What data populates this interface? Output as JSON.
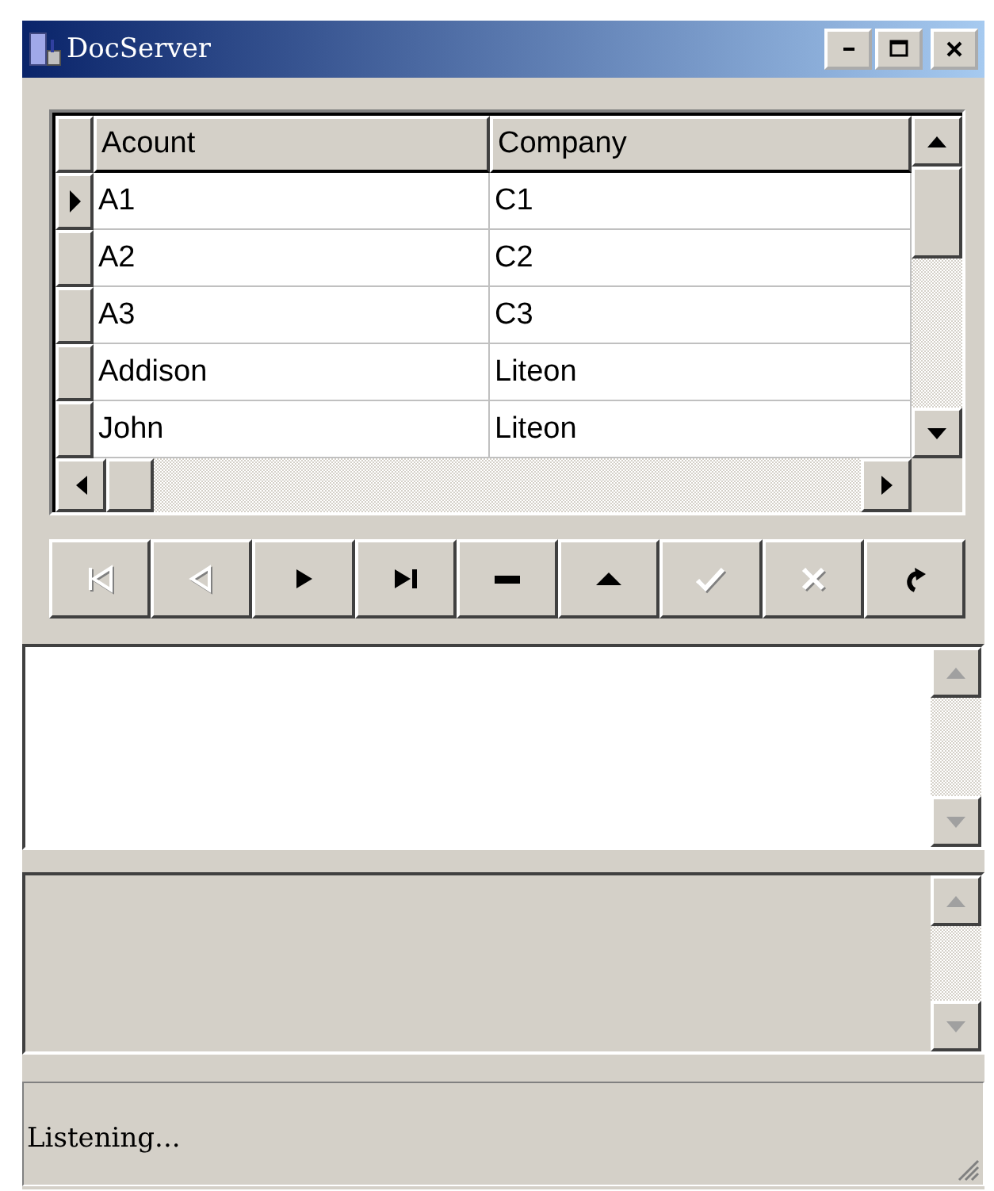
{
  "window": {
    "title": "DocServer"
  },
  "grid": {
    "columns": [
      "Acount",
      "Company"
    ],
    "rows": [
      {
        "cells": [
          "A1",
          "C1"
        ],
        "selected": true
      },
      {
        "cells": [
          "A2",
          "C2"
        ],
        "selected": false
      },
      {
        "cells": [
          "A3",
          "C3"
        ],
        "selected": false
      },
      {
        "cells": [
          "Addison",
          "Liteon"
        ],
        "selected": false
      },
      {
        "cells": [
          "John",
          "Liteon"
        ],
        "selected": false
      }
    ]
  },
  "navigator": [
    {
      "kind": "first",
      "disabled": true
    },
    {
      "kind": "prior",
      "disabled": true
    },
    {
      "kind": "next",
      "disabled": false
    },
    {
      "kind": "last",
      "disabled": false
    },
    {
      "kind": "delete",
      "disabled": false
    },
    {
      "kind": "edit",
      "disabled": false
    },
    {
      "kind": "post",
      "disabled": true
    },
    {
      "kind": "cancel",
      "disabled": true
    },
    {
      "kind": "refresh",
      "disabled": false
    }
  ],
  "memos": [
    {
      "disabled": false
    },
    {
      "disabled": true
    }
  ],
  "status_bar": {
    "text": "Listening..."
  }
}
